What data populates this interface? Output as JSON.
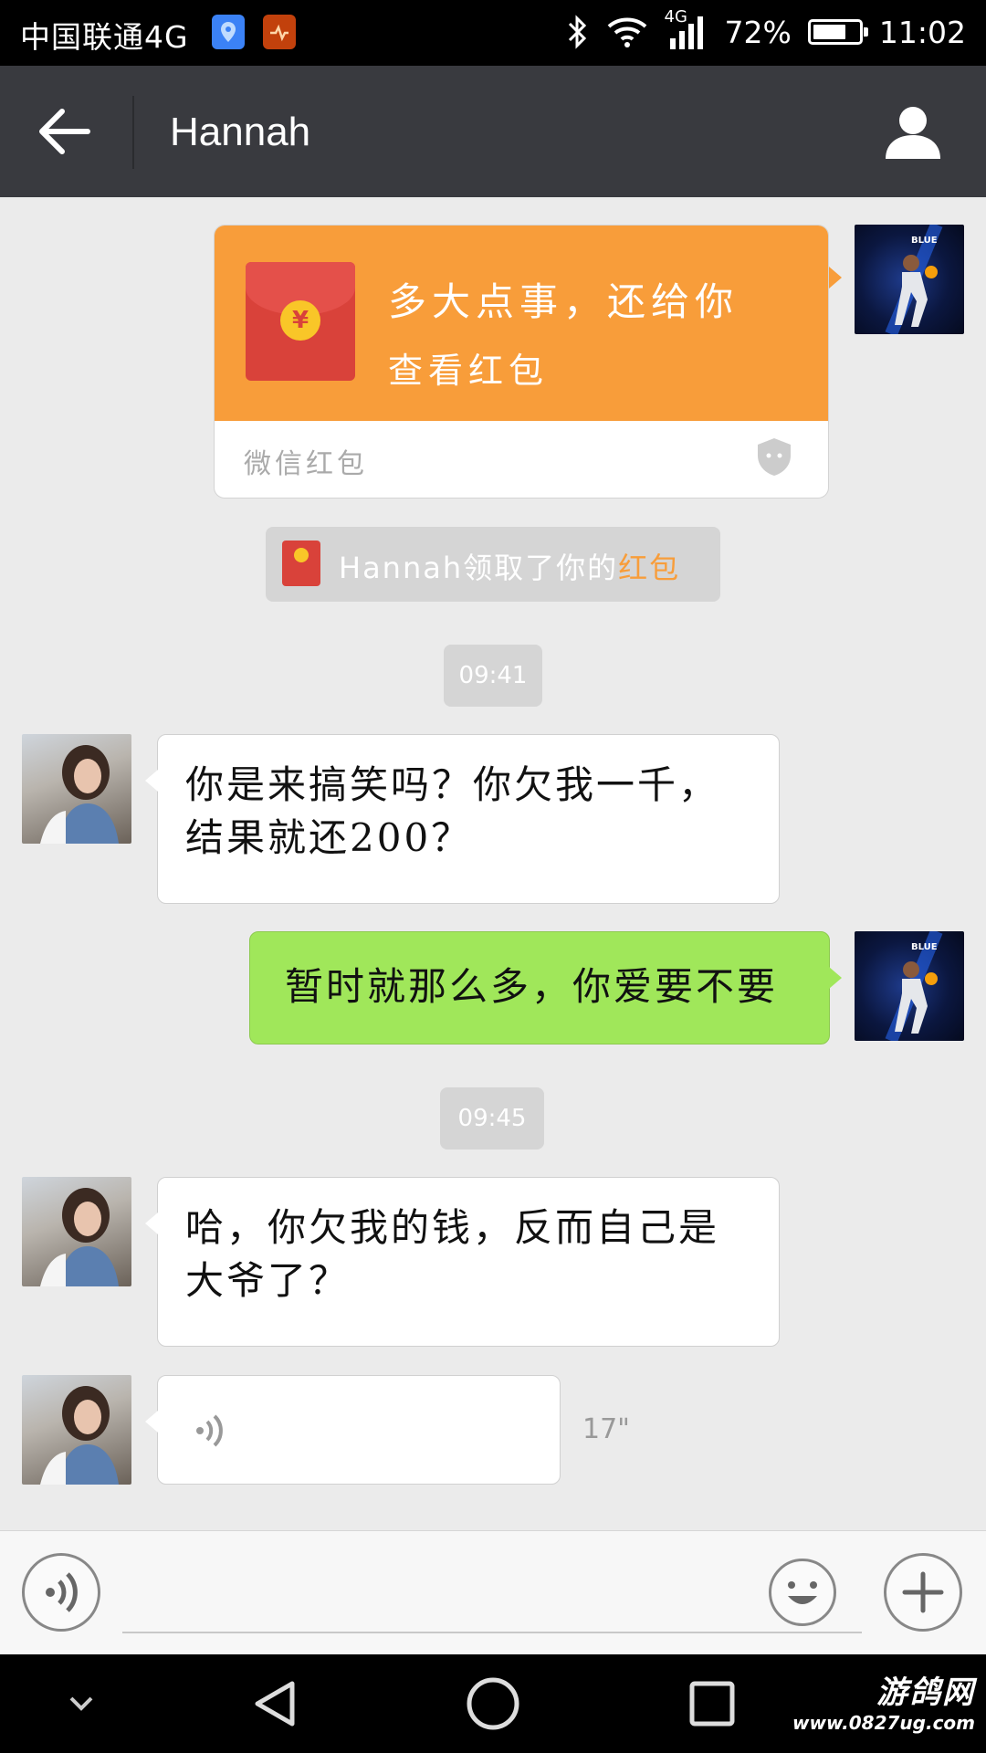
{
  "status_bar": {
    "carrier": "中国联通4G",
    "network": "4G",
    "battery": "72%",
    "battery_level": 0.72,
    "time": "11:02"
  },
  "header": {
    "title": "Hannah",
    "back_icon": "arrow-left-icon",
    "profile_icon": "person-icon"
  },
  "red_packet": {
    "message": "多大点事，还给你",
    "action": "查看红包",
    "footer": "微信红包",
    "color": "#f89d3a"
  },
  "notice": {
    "prefix": "Hannah领取了你的",
    "highlight": "红包"
  },
  "messages": {
    "ts1": "09:41",
    "m1": "你是来搞笑吗？你欠我一千，结果就还200？",
    "m2": "暂时就那么多，你爱要不要",
    "ts2": "09:45",
    "m3": "哈，你欠我的钱，反而自己是大爷了？",
    "voice_duration": "17\""
  },
  "input_bar": {
    "voice_icon": "voice-icon",
    "emoji_icon": "smiley-icon",
    "add_icon": "plus-icon"
  },
  "nav_bar": {
    "watermark_title": "游鸽网",
    "watermark_url": "www.0827ug.com"
  },
  "colors": {
    "header_bg": "#393a3f",
    "bubble_green": "#a0e75a",
    "red_packet_orange": "#f89d3a"
  }
}
